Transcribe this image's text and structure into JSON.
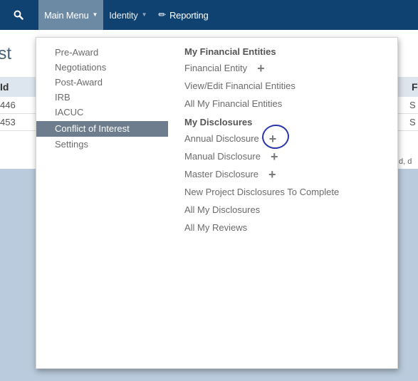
{
  "nav": {
    "search_icon": "search-icon",
    "main_menu": "Main Menu",
    "identity": "Identity",
    "reporting": "Reporting",
    "reporting_icon": "pencil-icon"
  },
  "background": {
    "title": "ist",
    "columns": [
      "Id",
      "F"
    ],
    "rows": [
      {
        "id": "446",
        "f": "S"
      },
      {
        "id": "453",
        "f": "S"
      }
    ],
    "note": "d, d"
  },
  "menu": {
    "left_items": [
      {
        "label": "Pre-Award"
      },
      {
        "label": "Negotiations"
      },
      {
        "label": "Post-Award"
      },
      {
        "label": "IRB"
      },
      {
        "label": "IACUC"
      },
      {
        "label": "Conflict of Interest",
        "active": true
      },
      {
        "label": "Settings"
      }
    ],
    "financial": {
      "heading": "My Financial Entities",
      "items": [
        {
          "label": "Financial Entity",
          "has_add": true
        },
        {
          "label": "View/Edit Financial Entities"
        },
        {
          "label": "All My Financial Entities"
        }
      ]
    },
    "disclosures": {
      "heading": "My Disclosures",
      "items": [
        {
          "label": "Annual Disclosure",
          "has_add": true,
          "circled": true
        },
        {
          "label": "Manual Disclosure",
          "has_add": true
        },
        {
          "label": "Master Disclosure",
          "has_add": true
        },
        {
          "label": "New Project Disclosures To Complete"
        },
        {
          "label": "All My Disclosures"
        },
        {
          "label": "All My Reviews"
        }
      ]
    },
    "plus_symbol": "+"
  },
  "colors": {
    "navbar": "#0f4271",
    "active_nav": "#6d8aa5",
    "active_menu_item": "#6d7d8d",
    "annotation_circle": "#2a36a8"
  }
}
